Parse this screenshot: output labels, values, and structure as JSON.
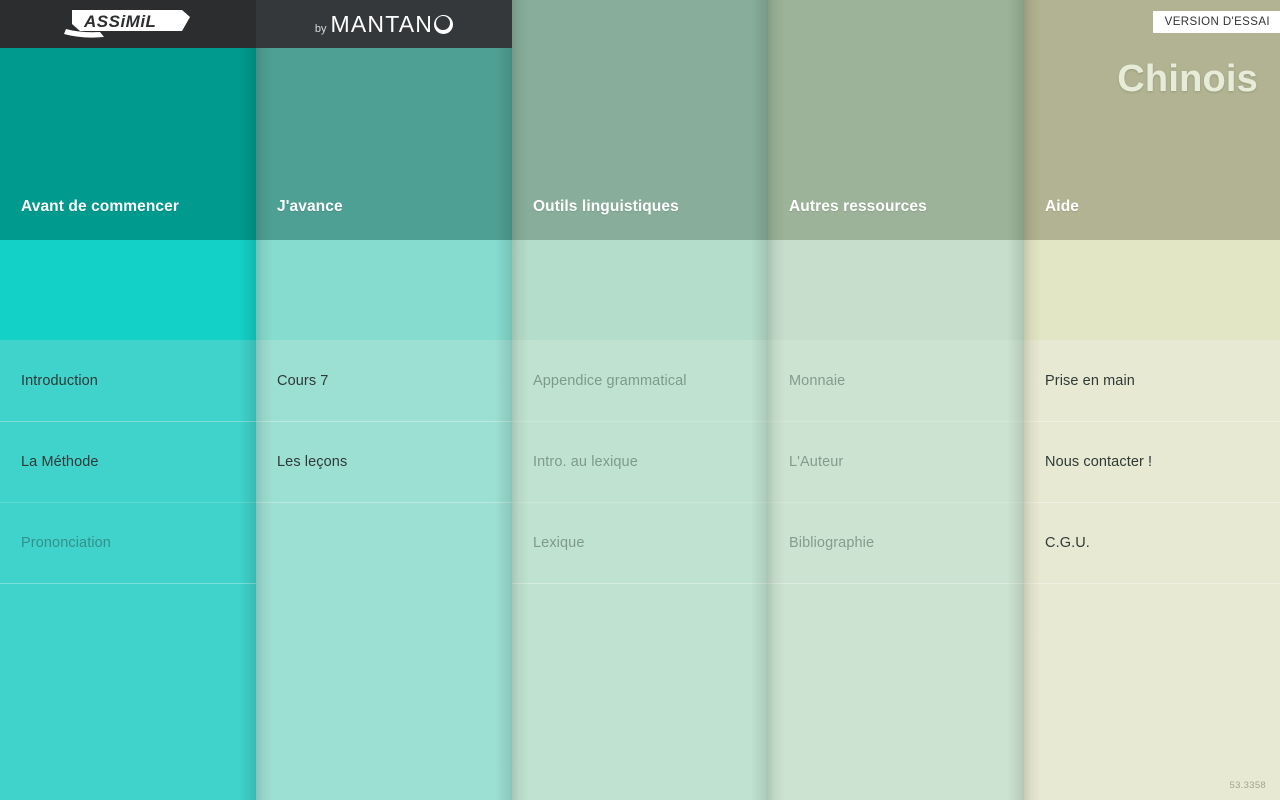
{
  "app": {
    "brand_primary": "ASSIMIL",
    "brand_secondary_prefix": "by",
    "brand_secondary": "MANTAN",
    "trial_badge": "VERSION D'ESSAI",
    "language_title": "Chinois",
    "version": "53.3358"
  },
  "colors": {
    "col1_header": "#009a8e",
    "col1_accent": "#13d1c6",
    "col1_body": "#3fd3cb",
    "col2_header": "#4fa094",
    "col2_accent": "#86dccf",
    "col2_body": "#9cdfd3",
    "col3_header": "#88ae9b",
    "col3_accent": "#b5ddcb",
    "col3_body": "#c0e2d1",
    "col4_header": "#9cb399",
    "col4_accent": "#c6decb",
    "col4_body": "#cde3d1",
    "col5_header": "#b1b392",
    "col5_accent": "#e2e6c5",
    "col5_body": "#e7e9d2",
    "topbar_a": "#2b2d2e",
    "topbar_b": "#35383a",
    "badge_bg": "#ffffff",
    "badge_text": "#333333",
    "title_text": "#e7ecd9",
    "version_text": "#a3a68c"
  },
  "columns": [
    {
      "title": "Avant de commencer",
      "items": [
        {
          "label": "Introduction",
          "dim": false
        },
        {
          "label": "La Méthode",
          "dim": false
        },
        {
          "label": "Prononciation",
          "dim": true
        }
      ]
    },
    {
      "title": "J'avance",
      "items": [
        {
          "label": "Cours 7",
          "dim": false
        },
        {
          "label": "Les leçons",
          "dim": false
        }
      ]
    },
    {
      "title": "Outils linguistiques",
      "items": [
        {
          "label": "Appendice grammatical",
          "dim": true
        },
        {
          "label": "Intro. au lexique",
          "dim": true
        },
        {
          "label": "Lexique",
          "dim": true
        }
      ]
    },
    {
      "title": "Autres ressources",
      "items": [
        {
          "label": "Monnaie",
          "dim": true
        },
        {
          "label": "L'Auteur",
          "dim": true
        },
        {
          "label": "Bibliographie",
          "dim": true
        }
      ]
    },
    {
      "title": "Aide",
      "items": [
        {
          "label": "Prise en main",
          "dim": false
        },
        {
          "label": "Nous contacter !",
          "dim": false
        },
        {
          "label": "C.G.U.",
          "dim": false
        }
      ]
    }
  ]
}
